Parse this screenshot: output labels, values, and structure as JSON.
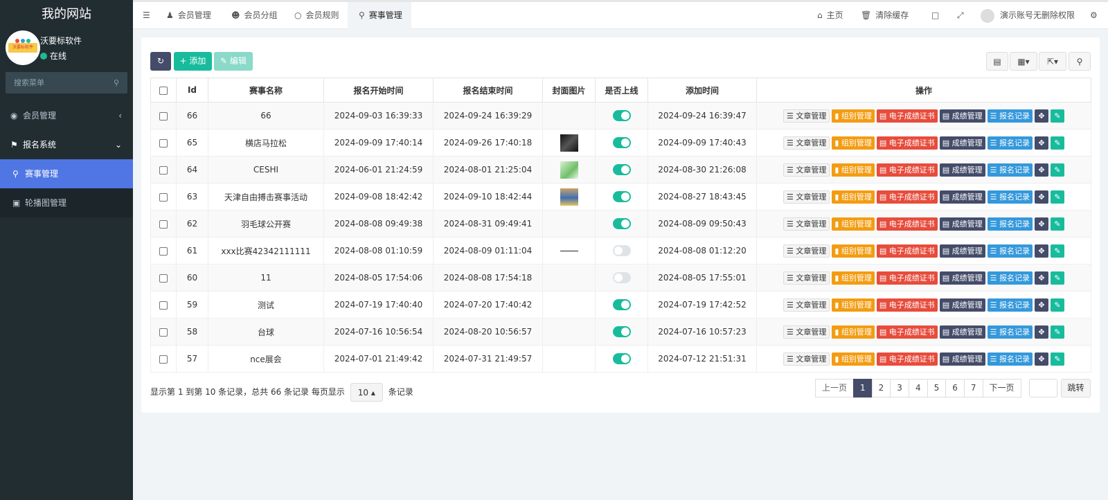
{
  "site": {
    "title": "我的网站"
  },
  "user": {
    "name": "沃要标软件",
    "status": "在线",
    "avatar_text": "沃要标软件"
  },
  "sidebar": {
    "search_placeholder": "搜索菜单",
    "items": [
      {
        "label": "会员管理",
        "icon": "user-circle-icon"
      },
      {
        "label": "报名系统",
        "icon": "flag-icon"
      },
      {
        "label": "赛事管理",
        "icon": "map-marker-icon"
      },
      {
        "label": "轮播图管理",
        "icon": "image-icon"
      }
    ]
  },
  "topbar": {
    "tabs": [
      "会员管理",
      "会员分组",
      "会员规则",
      "赛事管理"
    ],
    "home": "主页",
    "clear_cache": "清除缓存",
    "account": "演示账号无删除权限"
  },
  "toolbar": {
    "add": "添加",
    "edit": "编辑"
  },
  "table": {
    "headers": [
      "Id",
      "赛事名称",
      "报名开始时间",
      "报名结束时间",
      "封面图片",
      "是否上线",
      "添加时间",
      "操作"
    ],
    "ops": {
      "article": "文章管理",
      "group": "组别管理",
      "cert": "电子成绩证书",
      "score": "成绩管理",
      "signup": "报名记录"
    },
    "rows": [
      {
        "id": "66",
        "name": "66",
        "start": "2024-09-03 16:39:33",
        "end": "2024-09-24 16:39:29",
        "cover": "",
        "online": true,
        "added": "2024-09-24 16:39:47"
      },
      {
        "id": "65",
        "name": "横店马拉松",
        "start": "2024-09-09 17:40:14",
        "end": "2024-09-26 17:40:18",
        "cover": "dark",
        "online": true,
        "added": "2024-09-09 17:40:43"
      },
      {
        "id": "64",
        "name": "CESHI",
        "start": "2024-06-01 21:24:59",
        "end": "2024-08-01 21:25:04",
        "cover": "green",
        "online": true,
        "added": "2024-08-30 21:26:08"
      },
      {
        "id": "63",
        "name": "天津自由搏击赛事活动",
        "start": "2024-09-08 18:42:42",
        "end": "2024-09-10 18:42:44",
        "cover": "crowd",
        "online": true,
        "added": "2024-08-27 18:43:45"
      },
      {
        "id": "62",
        "name": "羽毛球公开赛",
        "start": "2024-08-08 09:49:38",
        "end": "2024-08-31 09:49:41",
        "cover": "",
        "online": true,
        "added": "2024-08-09 09:50:43"
      },
      {
        "id": "61",
        "name": "xxx比赛42342111111",
        "start": "2024-08-08 01:10:59",
        "end": "2024-08-09 01:11:04",
        "cover": "line",
        "online": false,
        "added": "2024-08-08 01:12:20"
      },
      {
        "id": "60",
        "name": "11",
        "start": "2024-08-05 17:54:06",
        "end": "2024-08-08 17:54:18",
        "cover": "",
        "online": false,
        "added": "2024-08-05 17:55:01"
      },
      {
        "id": "59",
        "name": "测试",
        "start": "2024-07-19 17:40:40",
        "end": "2024-07-20 17:40:42",
        "cover": "",
        "online": true,
        "added": "2024-07-19 17:42:52"
      },
      {
        "id": "58",
        "name": "台球",
        "start": "2024-07-16 10:56:54",
        "end": "2024-08-20 10:56:57",
        "cover": "",
        "online": true,
        "added": "2024-07-16 10:57:23"
      },
      {
        "id": "57",
        "name": "nce展会",
        "start": "2024-07-01 21:49:42",
        "end": "2024-07-31 21:49:57",
        "cover": "",
        "online": true,
        "added": "2024-07-12 21:51:31"
      }
    ]
  },
  "pagination": {
    "info_prefix": "显示第 1 到第 10 条记录，总共 66 条记录 每页显示",
    "page_size": "10",
    "info_suffix": "条记录",
    "prev": "上一页",
    "pages": [
      "1",
      "2",
      "3",
      "4",
      "5",
      "6",
      "7"
    ],
    "current": "1",
    "next": "下一页",
    "jump": "跳转"
  },
  "colors": {
    "accent": "#4f76e3",
    "sidebar": "#222d32",
    "success": "#18bc9c",
    "danger": "#e74c3c",
    "warning": "#f39c12",
    "info": "#3498db",
    "dark": "#444c69"
  }
}
